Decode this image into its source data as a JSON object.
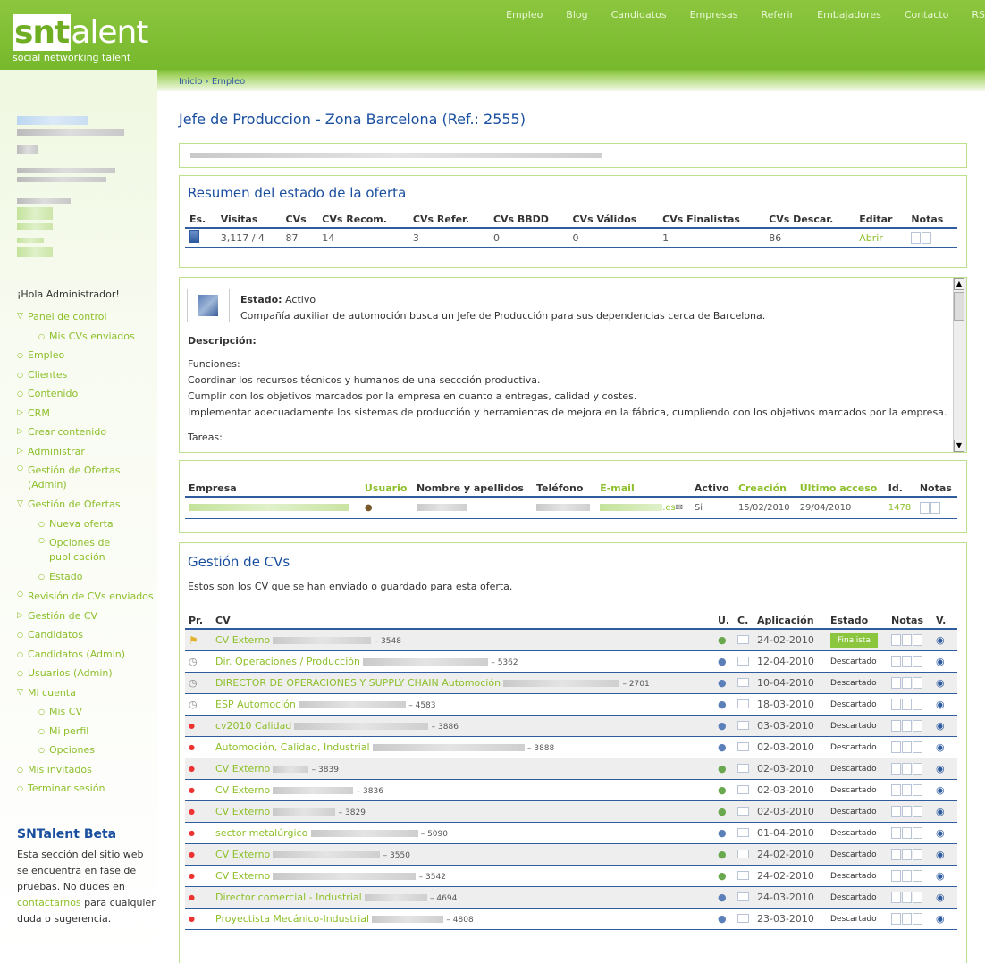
{
  "brand": {
    "name_box": "snt",
    "name_rest": "alent",
    "tagline": "social networking talent"
  },
  "topnav": [
    "Empleo",
    "Blog",
    "Candidatos",
    "Empresas",
    "Referir",
    "Embajadores",
    "Contacto",
    "RS"
  ],
  "breadcrumb": "Inicio › Empleo",
  "page_title": "Jefe de Produccion - Zona Barcelona (Ref.: 2555)",
  "sidebar": {
    "greeting": "¡Hola Administrador!",
    "menu": [
      {
        "label": "Panel de control",
        "kind": "tri"
      },
      {
        "label": "Mis CVs enviados",
        "kind": "sub"
      },
      {
        "label": "Empleo",
        "kind": "item"
      },
      {
        "label": "Clientes",
        "kind": "item"
      },
      {
        "label": "Contenido",
        "kind": "item"
      },
      {
        "label": "CRM",
        "kind": "tri-r"
      },
      {
        "label": "Crear contenido",
        "kind": "tri-r"
      },
      {
        "label": "Administrar",
        "kind": "tri-r"
      },
      {
        "label": "Gestión de Ofertas (Admin)",
        "kind": "item-two"
      },
      {
        "label": "Gestión de Ofertas",
        "kind": "tri"
      },
      {
        "label": "Nueva oferta",
        "kind": "sub"
      },
      {
        "label": "Opciones de publicación",
        "kind": "sub-two"
      },
      {
        "label": "Estado",
        "kind": "sub"
      },
      {
        "label": "Revisión de CVs enviados",
        "kind": "item-two"
      },
      {
        "label": "Gestión de CV",
        "kind": "tri-r"
      },
      {
        "label": "Candidatos",
        "kind": "item"
      },
      {
        "label": "Candidatos (Admin)",
        "kind": "item"
      },
      {
        "label": "Usuarios (Admin)",
        "kind": "item"
      },
      {
        "label": "Mi cuenta",
        "kind": "tri"
      },
      {
        "label": "Mis CV",
        "kind": "sub"
      },
      {
        "label": "Mi perfil",
        "kind": "sub"
      },
      {
        "label": "Opciones",
        "kind": "sub"
      },
      {
        "label": "Mis invitados",
        "kind": "item"
      },
      {
        "label": "Terminar sesión",
        "kind": "item"
      }
    ],
    "beta_title": "SNTalent Beta",
    "beta_text_1": "Esta sección del sitio web se encuentra en fase de pruebas. No dudes en ",
    "beta_link": "contactarnos",
    "beta_text_2": " para cualquier duda o sugerencia."
  },
  "summary": {
    "title": "Resumen del estado de la oferta",
    "headers": [
      "Es.",
      "Visitas",
      "CVs",
      "CVs Recom.",
      "CVs Refer.",
      "CVs BBDD",
      "CVs Válidos",
      "CVs Finalistas",
      "CVs Descar.",
      "Editar",
      "Notas"
    ],
    "row": {
      "visitas": "3,117 / 4",
      "cvs": "87",
      "recom": "14",
      "refer": "3",
      "bbdd": "0",
      "validos": "0",
      "finalistas": "1",
      "descar": "86",
      "editar": "Abrir"
    }
  },
  "description": {
    "estado_label": "Estado:",
    "estado_value": "Activo",
    "summary": "Compañía auxiliar de automoción busca un Jefe de Producción para sus dependencias cerca de Barcelona.",
    "desc_label": "Descripción:",
    "lines": [
      "Funciones:",
      "Coordinar los recursos técnicos y humanos de una seccción productiva.",
      "Cumplir con los objetivos marcados por la empresa en cuanto a entregas, calidad y costes.",
      "Implementar adecuadamente los sistemas de producción y herramientas de mejora en la fábrica, cumpliendo con los objetivos marcados por la empresa."
    ],
    "tareas": "Tareas:"
  },
  "company": {
    "headers": [
      "Empresa",
      "Usuario",
      "Nombre y apellidos",
      "Teléfono",
      "E-mail",
      "Activo",
      "Creación",
      "Último acceso",
      "Id.",
      "Notas"
    ],
    "email_suffix": ".es",
    "activo": "Si",
    "creacion": "15/02/2010",
    "ultimo": "29/04/2010",
    "id": "1478"
  },
  "cvs": {
    "title": "Gestión de CVs",
    "subtitle": "Estos son los CV que se han enviado o guardado para esta oferta.",
    "headers": [
      "Pr.",
      "CV",
      "U.",
      "C.",
      "Aplicación",
      "Estado",
      "Notas",
      "V."
    ],
    "rows": [
      {
        "name": "CV Externo",
        "ref": "– 3548",
        "date": "24-02-2010",
        "estado": "Finalista",
        "pr": "flag",
        "user": "green"
      },
      {
        "name": "Dir. Operaciones / Producción",
        "ref": "– 5362",
        "date": "12-04-2010",
        "estado": "Descartado",
        "pr": "clock",
        "user": "blue"
      },
      {
        "name": "DIRECTOR DE OPERACIONES Y SUPPLY CHAIN Automoción",
        "ref": "– 2701",
        "date": "10-04-2010",
        "estado": "Descartado",
        "pr": "clock",
        "user": "blue"
      },
      {
        "name": "ESP Automoción",
        "ref": "– 4583",
        "date": "18-03-2010",
        "estado": "Descartado",
        "pr": "clock",
        "user": "blue"
      },
      {
        "name": "cv2010 Calidad",
        "ref": "– 3886",
        "date": "03-03-2010",
        "estado": "Descartado",
        "pr": "dot",
        "user": "blue"
      },
      {
        "name": "Automoción, Calidad, Industrial",
        "ref": "– 3888",
        "date": "02-03-2010",
        "estado": "Descartado",
        "pr": "dot",
        "user": "blue"
      },
      {
        "name": "CV Externo",
        "ref": "– 3839",
        "date": "02-03-2010",
        "estado": "Descartado",
        "pr": "dot",
        "user": "green"
      },
      {
        "name": "CV Externo",
        "ref": "– 3836",
        "date": "02-03-2010",
        "estado": "Descartado",
        "pr": "dot",
        "user": "green"
      },
      {
        "name": "CV Externo",
        "ref": "– 3829",
        "date": "02-03-2010",
        "estado": "Descartado",
        "pr": "dot",
        "user": "green"
      },
      {
        "name": "sector metalúrgico",
        "ref": "– 5090",
        "date": "01-04-2010",
        "estado": "Descartado",
        "pr": "dot",
        "user": "blue"
      },
      {
        "name": "CV Externo",
        "ref": "– 3550",
        "date": "24-02-2010",
        "estado": "Descartado",
        "pr": "dot",
        "user": "green"
      },
      {
        "name": "CV Externo",
        "ref": "– 3542",
        "date": "24-02-2010",
        "estado": "Descartado",
        "pr": "dot",
        "user": "green"
      },
      {
        "name": "Director comercial - Industrial",
        "ref": "– 4694",
        "date": "24-03-2010",
        "estado": "Descartado",
        "pr": "dot",
        "user": "blue"
      },
      {
        "name": "Proyectista Mecánico-Industrial",
        "ref": "– 4808",
        "date": "23-03-2010",
        "estado": "Descartado",
        "pr": "dot",
        "user": "blue"
      }
    ]
  }
}
